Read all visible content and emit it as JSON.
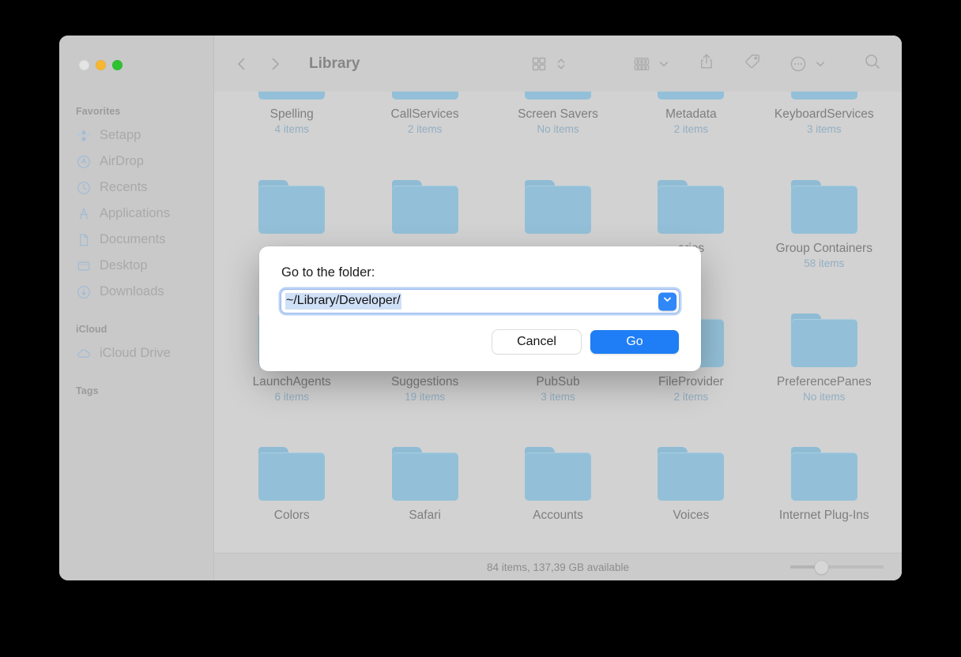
{
  "window": {
    "title": "Library",
    "traffic_lights": [
      {
        "name": "close",
        "color": "#e4e4e4"
      },
      {
        "name": "minimize",
        "color": "#f7b733"
      },
      {
        "name": "maximize",
        "color": "#2fc12f"
      }
    ]
  },
  "toolbar": {
    "back_icon": "chevron-left-icon",
    "forward_icon": "chevron-right-icon",
    "title": "Library",
    "view_icon": "icon-view-icon",
    "view_chevron_icon": "chevron-updown-icon",
    "group_icon": "group-by-icon",
    "group_chevron_icon": "chevron-down-icon",
    "share_icon": "share-icon",
    "tag_icon": "tag-icon",
    "more_icon": "ellipsis-circle-icon",
    "more_chevron_icon": "chevron-down-icon",
    "search_icon": "search-icon"
  },
  "sidebar": {
    "sections": [
      {
        "title": "Favorites",
        "items": [
          {
            "label": "Setapp",
            "icon": "setapp-icon"
          },
          {
            "label": "AirDrop",
            "icon": "airdrop-icon"
          },
          {
            "label": "Recents",
            "icon": "clock-icon"
          },
          {
            "label": "Applications",
            "icon": "applications-icon"
          },
          {
            "label": "Documents",
            "icon": "document-icon"
          },
          {
            "label": "Desktop",
            "icon": "desktop-icon"
          },
          {
            "label": "Downloads",
            "icon": "download-icon"
          }
        ]
      },
      {
        "title": "iCloud",
        "items": [
          {
            "label": "iCloud Drive",
            "icon": "cloud-icon"
          }
        ]
      },
      {
        "title": "Tags",
        "items": []
      }
    ]
  },
  "files": {
    "rows": [
      [
        {
          "name": "Spelling",
          "count": "4 items"
        },
        {
          "name": "CallServices",
          "count": "2 items"
        },
        {
          "name": "Screen Savers",
          "count": "No items"
        },
        {
          "name": "Metadata",
          "count": "2 items"
        },
        {
          "name": "KeyboardServices",
          "count": "3 items"
        }
      ],
      [
        {
          "name": "",
          "count": ""
        },
        {
          "name": "",
          "count": ""
        },
        {
          "name": "",
          "count": ""
        },
        {
          "name": "aries",
          "count": ""
        },
        {
          "name": "Group Containers",
          "count": "58 items"
        }
      ],
      [
        {
          "name": "LaunchAgents",
          "count": "6 items"
        },
        {
          "name": "Suggestions",
          "count": "19 items"
        },
        {
          "name": "PubSub",
          "count": "3 items"
        },
        {
          "name": "FileProvider",
          "count": "2 items"
        },
        {
          "name": "PreferencePanes",
          "count": "No items"
        }
      ],
      [
        {
          "name": "Colors",
          "count": ""
        },
        {
          "name": "Safari",
          "count": ""
        },
        {
          "name": "Accounts",
          "count": ""
        },
        {
          "name": "Voices",
          "count": ""
        },
        {
          "name": "Internet Plug-Ins",
          "count": ""
        }
      ]
    ]
  },
  "statusbar": {
    "text": "84 items, 137,39 GB available",
    "zoom_value": 33
  },
  "dialog": {
    "label": "Go to the folder:",
    "input_value": "~/Library/Developer/",
    "dropdown_icon": "chevron-down-icon",
    "cancel_label": "Cancel",
    "go_label": "Go",
    "accent_color": "#1f7ef5"
  }
}
